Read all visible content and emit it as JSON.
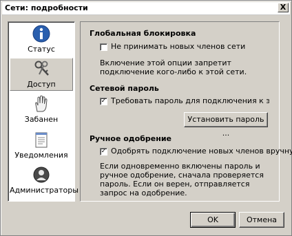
{
  "window": {
    "title": "Сети: подробности",
    "close_glyph": "X"
  },
  "sidebar": {
    "items": [
      {
        "label": "Статус",
        "icon": "info-icon"
      },
      {
        "label": "Доступ",
        "icon": "keys-icon",
        "active": true
      },
      {
        "label": "Забанен",
        "icon": "hand-stop-icon"
      },
      {
        "label": "Уведомления",
        "icon": "notepad-icon"
      },
      {
        "label": "Администраторы",
        "icon": "admin-badge-icon"
      }
    ]
  },
  "content": {
    "global_lock": {
      "title": "Глобальная блокировка",
      "checkbox_label": "Не принимать новых членов сети",
      "checked": false,
      "description": "Включение этой опции запретит подключение кого-либо к этой сети."
    },
    "network_password": {
      "title": "Сетевой пароль",
      "checkbox_label": "Требовать пароль для подключения к этой сети",
      "checked": true,
      "set_password_button": "Установить пароль ..."
    },
    "manual_approval": {
      "title": "Ручное одобрение",
      "checkbox_label": "Одобрять подключение новых членов вручную",
      "checked": true,
      "description": "Если одновременно включены пароль и ручное одобрение, сначала проверяется пароль. Если он верен, отправляется запрос на одобрение."
    }
  },
  "footer": {
    "ok_label": "OK",
    "cancel_label": "Отмена"
  },
  "colors": {
    "dialog_bg": "#d4d0c8",
    "sidebar_bg": "#ffffff",
    "icon_blue": "#2a5fae"
  }
}
